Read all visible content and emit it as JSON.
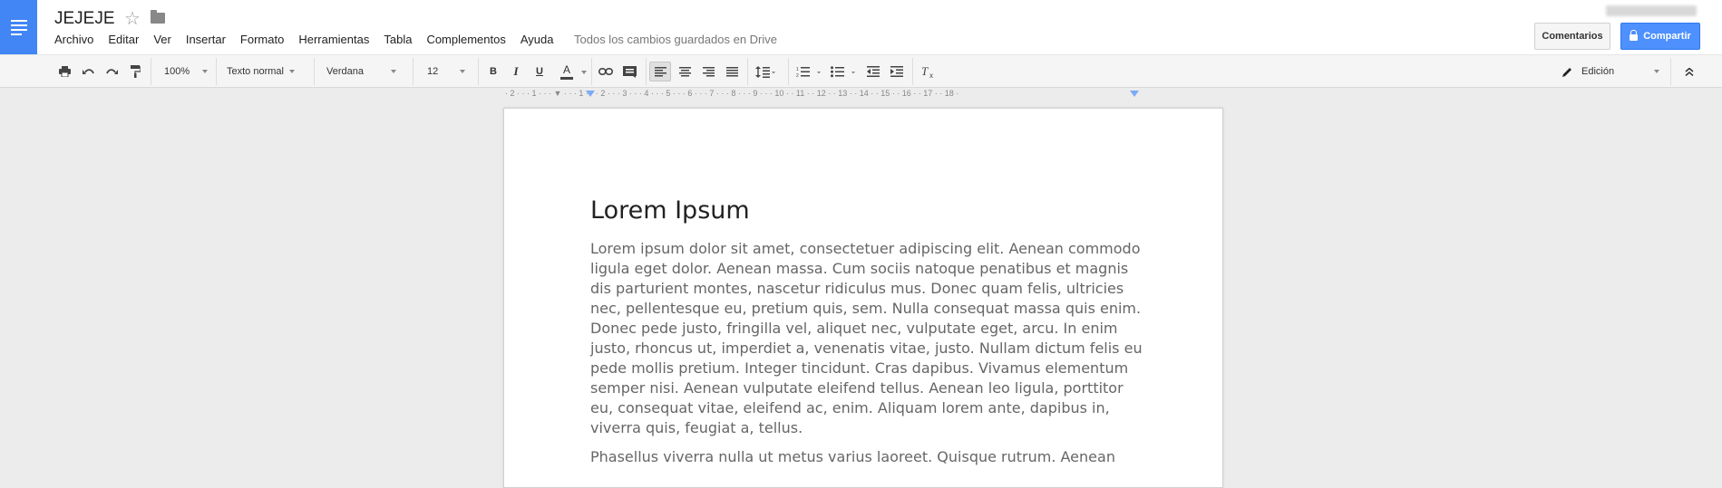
{
  "document": {
    "title": "JEJEJE",
    "save_status": "Todos los cambios guardados en Drive"
  },
  "menu": [
    "Archivo",
    "Editar",
    "Ver",
    "Insertar",
    "Formato",
    "Herramientas",
    "Tabla",
    "Complementos",
    "Ayuda"
  ],
  "header_buttons": {
    "comments": "Comentarios",
    "share": "Compartir"
  },
  "toolbar": {
    "zoom": "100%",
    "style": "Texto normal",
    "font": "Verdana",
    "font_size": "12",
    "bold": "B",
    "italic": "I",
    "underline": "U",
    "text_color": "A",
    "mode": "Edición"
  },
  "ruler": {
    "labels": "· 2 · · · 1 · · · ▼ · · · 1 · · · 2 · · · 3 · · · 4 · · · 5 · · · 6 · · · 7 · · · 8 · · · 9 · · · 10 · · 11 · · 12 · · 13 · · 14 · · 15 · · 16 · · 17 · · 18 ·"
  },
  "content": {
    "heading": "Lorem Ipsum",
    "paragraph_1": "Lorem ipsum dolor sit amet, consectetuer adipiscing elit. Aenean commodo ligula eget dolor. Aenean massa. Cum sociis natoque penatibus et magnis dis parturient montes, nascetur ridiculus mus. Donec quam felis, ultricies nec, pellentesque eu, pretium quis, sem. Nulla consequat massa quis enim. Donec pede justo, fringilla vel, aliquet nec, vulputate eget, arcu. In enim justo, rhoncus ut, imperdiet a, venenatis vitae, justo. Nullam dictum felis eu pede mollis pretium. Integer tincidunt. Cras dapibus. Vivamus elementum semper nisi. Aenean vulputate eleifend tellus. Aenean leo ligula, porttitor eu, consequat vitae, eleifend ac, enim. Aliquam lorem ante, dapibus in, viverra quis, feugiat a, tellus.",
    "paragraph_2": "Phasellus viverra nulla ut metus varius laoreet. Quisque rutrum. Aenean"
  },
  "colors": {
    "brand_blue": "#4285f4",
    "share_button": "#4d90fe",
    "text_color_underline": "#444444"
  },
  "icons": [
    "docs-logo-icon",
    "star-icon",
    "folder-icon",
    "lock-icon",
    "print-icon",
    "undo-icon",
    "redo-icon",
    "paint-format-icon",
    "link-icon",
    "comment-icon",
    "align-left-icon",
    "align-center-icon",
    "align-right-icon",
    "align-justify-icon",
    "line-spacing-icon",
    "numbered-list-icon",
    "bulleted-list-icon",
    "decrease-indent-icon",
    "increase-indent-icon",
    "clear-formatting-icon",
    "pencil-icon",
    "collapse-icon"
  ]
}
